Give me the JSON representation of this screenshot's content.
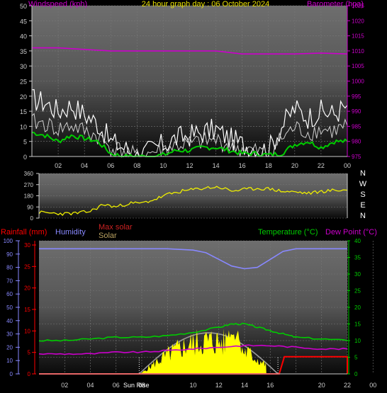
{
  "title": "24 hour graph day : 06 October 2024",
  "chart_data": [
    {
      "type": "line",
      "panel": "wind",
      "left_label": "Windspeed (kph)",
      "right_label": "Barometer (hpa)",
      "left_ticks": [
        "0",
        "5",
        "10",
        "15",
        "20",
        "25",
        "30",
        "35",
        "40",
        "45",
        "50"
      ],
      "right_ticks": [
        "975",
        "980",
        "985",
        "990",
        "995",
        "1000",
        "1005",
        "1010",
        "1015",
        "1020",
        "1025"
      ],
      "x_ticks": [
        "02",
        "04",
        "06",
        "08",
        "10",
        "12",
        "14",
        "16",
        "18",
        "20",
        "22",
        "00"
      ],
      "ylim_left": [
        0,
        50
      ],
      "ylim_right": [
        975,
        1025
      ],
      "colors": {
        "gust": "#ffffff",
        "speed": "#cfcfcf",
        "average": "#00cc00",
        "barometer": "#cc00cc"
      },
      "barometer": {
        "x": [
          0,
          2,
          4,
          6,
          8,
          10,
          12,
          14,
          16,
          18,
          20,
          22,
          24
        ],
        "y": [
          1011,
          1011,
          1010.5,
          1010,
          1010,
          1010,
          1010,
          1010,
          1009,
          1009,
          1009,
          1009.3,
          1009
        ]
      },
      "gust": {
        "x": [
          0,
          1,
          2,
          3,
          4,
          5,
          6,
          7,
          8,
          9,
          10,
          11,
          12,
          13,
          14,
          15,
          16,
          17,
          18,
          19,
          20,
          21,
          22,
          23,
          24
        ],
        "y": [
          19,
          18,
          15,
          17,
          14,
          11,
          5,
          3,
          0,
          2,
          4,
          6,
          7,
          8,
          9,
          6,
          4,
          3,
          2,
          10,
          16,
          13,
          15,
          14,
          17
        ]
      },
      "average": {
        "x": [
          0,
          1,
          2,
          3,
          4,
          5,
          6,
          7,
          8,
          9,
          10,
          11,
          12,
          13,
          14,
          15,
          16,
          17,
          18,
          19,
          20,
          21,
          22,
          23,
          24
        ],
        "y": [
          8,
          7,
          5,
          7,
          6,
          5,
          1,
          0,
          0,
          0,
          0.5,
          2,
          2,
          3,
          3,
          2,
          1,
          1,
          0.5,
          1,
          4,
          5,
          3,
          5,
          5
        ]
      }
    },
    {
      "type": "line",
      "panel": "direction",
      "left_ticks": [
        "0",
        "90",
        "180",
        "270",
        "360"
      ],
      "right_ticks": [
        "N",
        "W",
        "S",
        "E",
        "N"
      ],
      "ylim": [
        0,
        360
      ],
      "colors": {
        "direction": "#eeee00"
      },
      "direction": {
        "x": [
          0,
          1,
          2,
          3,
          4,
          5,
          6,
          7,
          8,
          9,
          10,
          11,
          12,
          13,
          14,
          15,
          16,
          17,
          18,
          19,
          20,
          21,
          22,
          23,
          24
        ],
        "y": [
          45,
          40,
          35,
          40,
          55,
          110,
          90,
          120,
          120,
          150,
          190,
          215,
          230,
          245,
          250,
          220,
          230,
          240,
          235,
          215,
          210,
          200,
          215,
          225,
          225
        ]
      }
    },
    {
      "type": "line",
      "panel": "rain_temp",
      "left_label_rain": "Rainfall (mm)",
      "left_label_hum": "Humidity",
      "mid_label_max": "Max solar",
      "mid_label_solar": "Solar",
      "right_label_temp": "Temperature (°C)",
      "right_label_dew": "Dew Point (°C)",
      "hum_ticks": [
        "0",
        "10",
        "20",
        "30",
        "40",
        "50",
        "60",
        "70",
        "80",
        "90",
        "100"
      ],
      "rain_ticks": [
        "0",
        "5",
        "10",
        "15",
        "20",
        "25",
        "30"
      ],
      "temp_ticks": [
        "0",
        "5",
        "10",
        "15",
        "20",
        "25",
        "30",
        "35",
        "40"
      ],
      "x_ticks": [
        "02",
        "04",
        "06",
        "08",
        "",
        "10",
        "12",
        "14",
        "16",
        "",
        "20",
        "22",
        "00"
      ],
      "sunrise_label": "Sun Rise",
      "colors": {
        "humidity": "#8888ff",
        "temperature": "#00cc00",
        "dew_point": "#cc00cc",
        "solar": "#ffff00",
        "max_solar": "#999999",
        "rain": "#ff0000"
      },
      "humidity": {
        "x": [
          0,
          2,
          4,
          6,
          8,
          10,
          12,
          13,
          14,
          15,
          16,
          17,
          18,
          19,
          20,
          22,
          24
        ],
        "y": [
          94,
          94,
          94,
          94,
          94,
          94,
          93,
          91,
          86,
          81,
          79,
          80,
          86,
          92,
          94,
          94,
          94
        ]
      },
      "temperature": {
        "x": [
          0,
          2,
          4,
          6,
          8,
          10,
          12,
          14,
          15,
          16,
          17,
          18,
          19,
          20,
          22,
          24
        ],
        "y": [
          10,
          10,
          10.5,
          11,
          11,
          11.5,
          12.5,
          14,
          15,
          15,
          14,
          13,
          12,
          11,
          10.5,
          10
        ]
      },
      "dew_point": {
        "x": [
          0,
          2,
          4,
          6,
          8,
          10,
          12,
          14,
          16,
          18,
          20,
          22,
          24
        ],
        "y": [
          6,
          6,
          6,
          6.5,
          6.5,
          7,
          7.5,
          8,
          8.5,
          8.5,
          8,
          7.5,
          7.5
        ]
      },
      "rain": {
        "x": [
          0,
          18.7,
          18.8,
          19,
          24
        ],
        "y": [
          0,
          0,
          0,
          4,
          4
        ]
      }
    }
  ]
}
